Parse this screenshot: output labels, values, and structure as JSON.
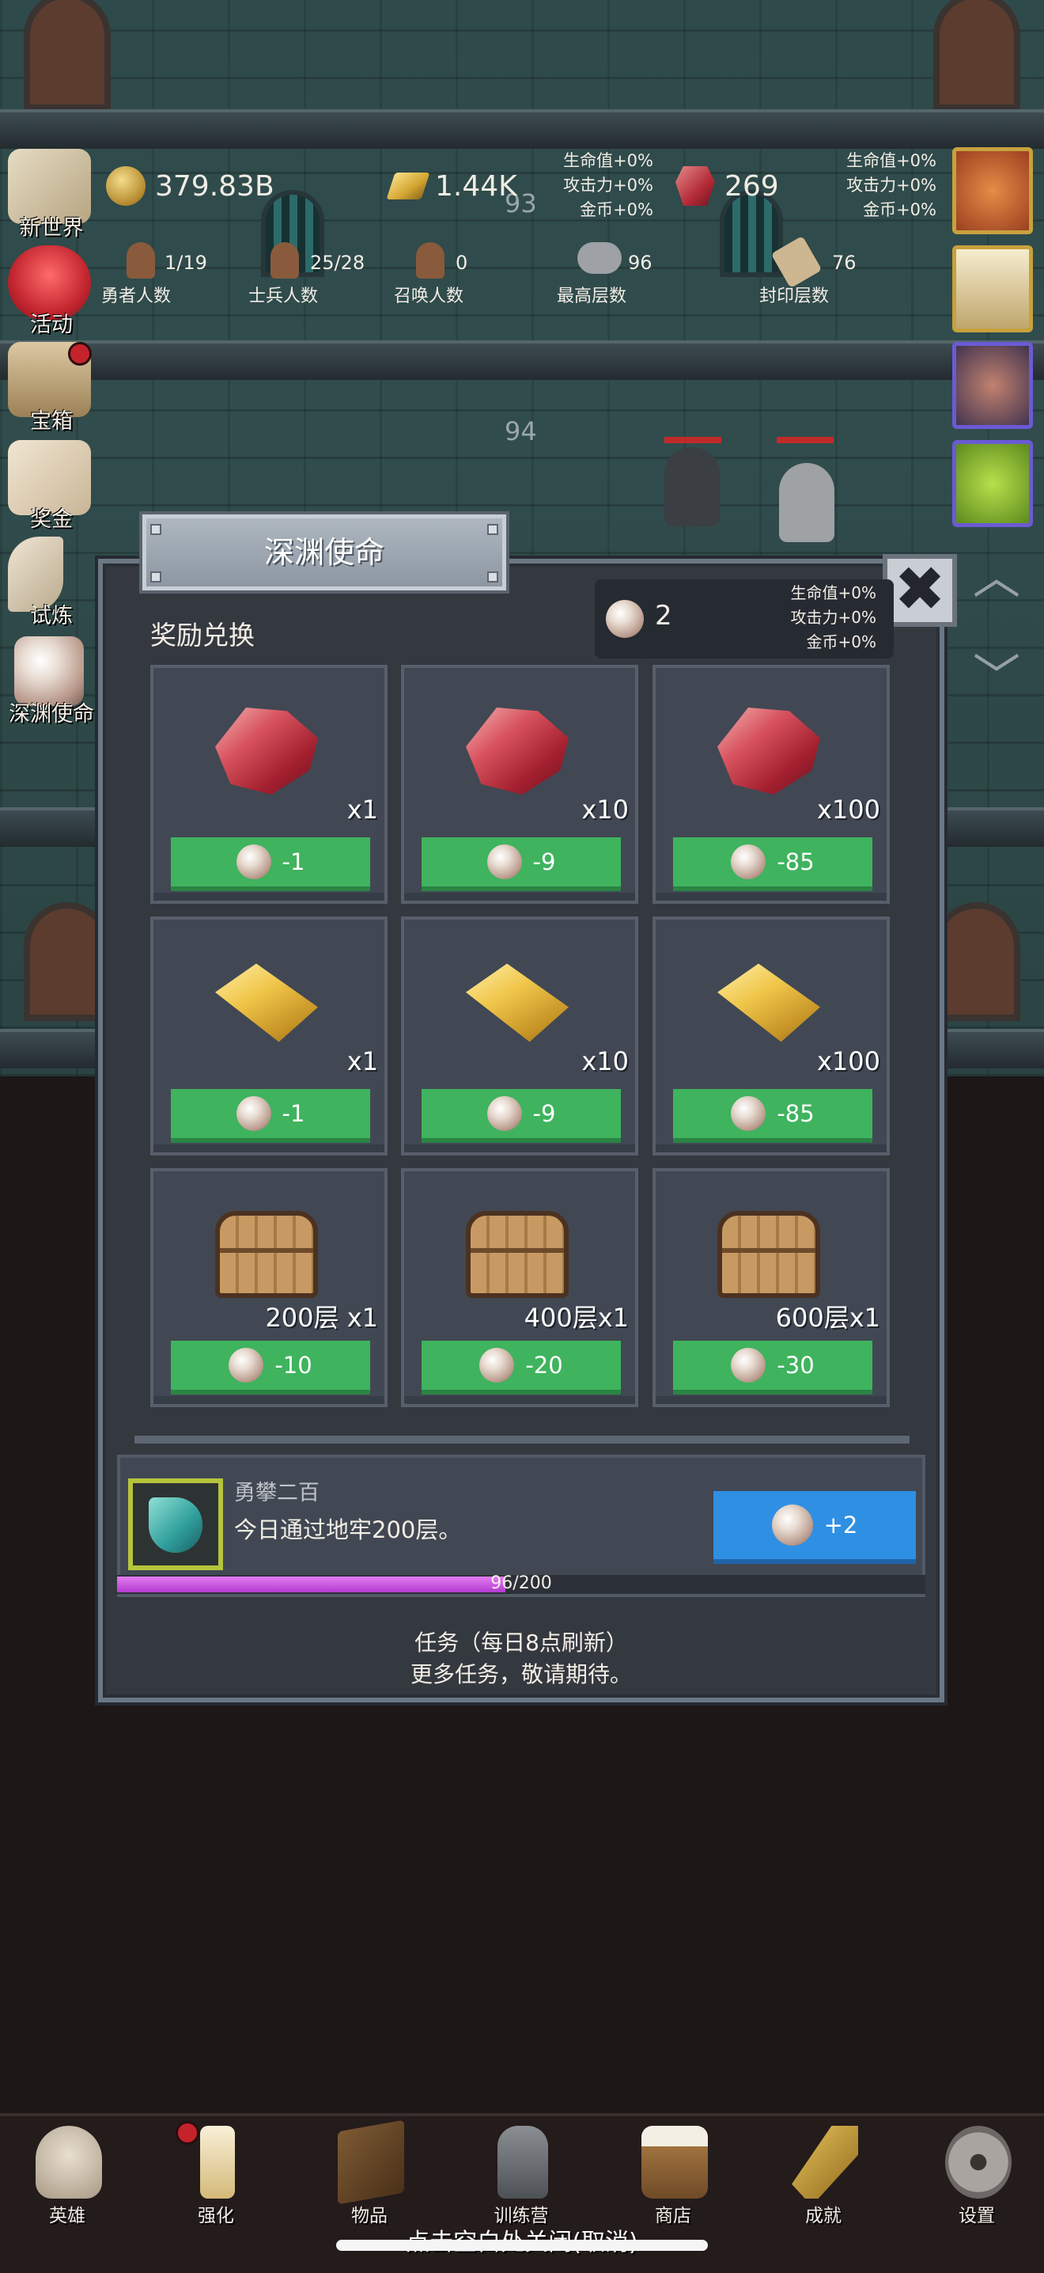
{
  "hud": {
    "gold": "379.83B",
    "gold_bar": "1.44K",
    "ruby": "269",
    "left_stats": [
      "生命值+0%",
      "攻击力+0%",
      "金币+0%"
    ],
    "right_stats": [
      "生命值+0%",
      "攻击力+0%",
      "金币+0%"
    ],
    "counts": [
      {
        "value": "1/19",
        "label": "勇者人数"
      },
      {
        "value": "25/28",
        "label": "士兵人数"
      },
      {
        "value": "0",
        "label": "召唤人数"
      },
      {
        "value": "96",
        "label": "最高层数"
      },
      {
        "value": "76",
        "label": "封印层数"
      }
    ],
    "floors": [
      "93",
      "94"
    ]
  },
  "side_menu": [
    {
      "label": "新世界",
      "icon": "map-icon"
    },
    {
      "label": "活动",
      "icon": "heart-icon"
    },
    {
      "label": "宝箱",
      "icon": "chest-icon",
      "badge": true
    },
    {
      "label": "奖金",
      "icon": "envelope-icon"
    },
    {
      "label": "试炼",
      "icon": "quill-icon"
    },
    {
      "label": "深渊使命",
      "icon": "pearl-icon"
    }
  ],
  "modal": {
    "title": "深渊使命",
    "close_glyph": "✖",
    "exchange_title": "奖励兑换",
    "pearl_count": "2",
    "pearl_stats": [
      "生命值+0%",
      "攻击力+0%",
      "金币+0%"
    ],
    "rewards": [
      {
        "item": "ruby",
        "qty": "x1",
        "cost": "-1"
      },
      {
        "item": "ruby",
        "qty": "x10",
        "cost": "-9"
      },
      {
        "item": "ruby",
        "qty": "x100",
        "cost": "-85"
      },
      {
        "item": "gold-bar",
        "qty": "x1",
        "cost": "-1"
      },
      {
        "item": "gold-bar",
        "qty": "x10",
        "cost": "-9"
      },
      {
        "item": "gold-bar",
        "qty": "x100",
        "cost": "-85"
      },
      {
        "item": "chest",
        "qty": "200层 x1",
        "cost": "-10"
      },
      {
        "item": "chest",
        "qty": "400层x1",
        "cost": "-20"
      },
      {
        "item": "chest",
        "qty": "600层x1",
        "cost": "-30"
      }
    ],
    "task": {
      "name": "勇攀二百",
      "description": "今日通过地牢200层。",
      "reward": "+2",
      "progress_text": "96/200",
      "progress": 0.48
    },
    "footer_line1": "任务（每日8点刷新）",
    "footer_line2": "更多任务，敬请期待。"
  },
  "nav": [
    {
      "label": "英雄",
      "icon": "skull-icon"
    },
    {
      "label": "强化",
      "icon": "candle-icon",
      "badge": true
    },
    {
      "label": "物品",
      "icon": "book-icon"
    },
    {
      "label": "训练营",
      "icon": "lantern-icon"
    },
    {
      "label": "商店",
      "icon": "mug-icon"
    },
    {
      "label": "成就",
      "icon": "key-icon"
    },
    {
      "label": "设置",
      "icon": "gear-icon"
    }
  ],
  "hint": "点击空白处关闭(取消)",
  "colors": {
    "buy_green": "#3fb35e",
    "task_blue": "#2f8fe3",
    "progress_purple": "#b33ad1"
  }
}
